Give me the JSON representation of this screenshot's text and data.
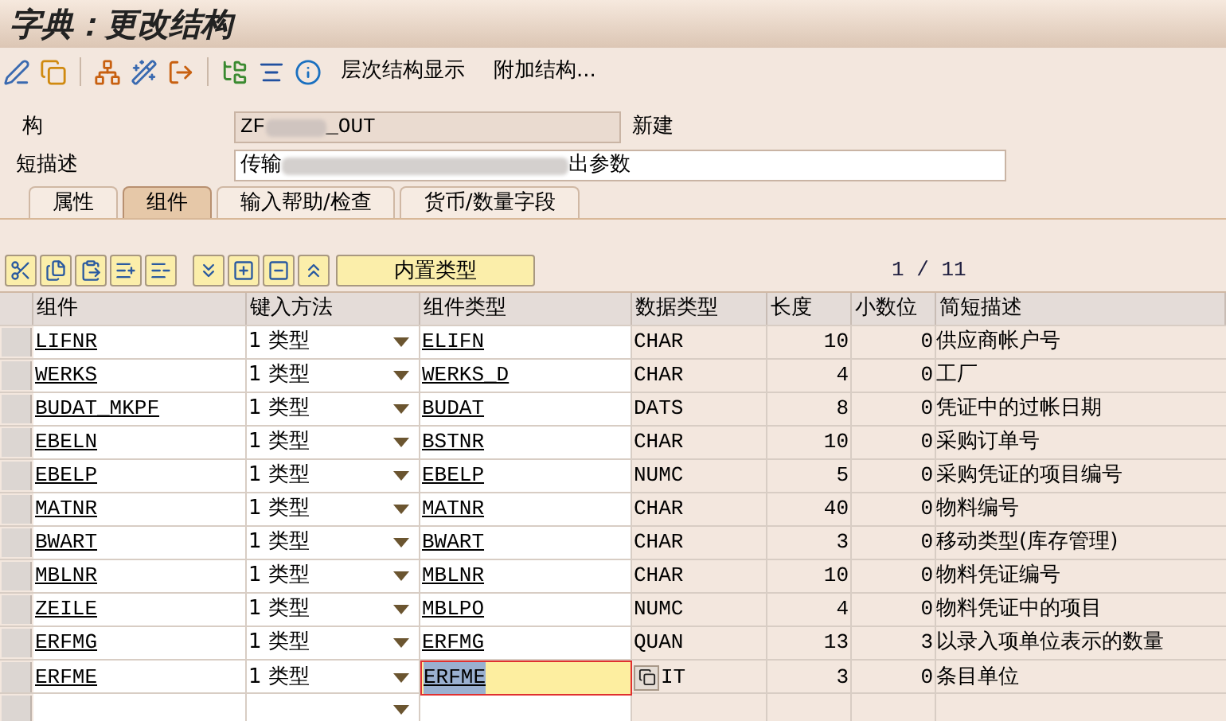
{
  "window": {
    "title": "字典：更改结构"
  },
  "toolbar": {
    "buttons": [
      "层次结构显示",
      "附加结构..."
    ]
  },
  "form": {
    "structure": {
      "label": "构",
      "value_start": "ZF",
      "value_end": "_OUT",
      "status": "新建"
    },
    "description": {
      "label": "短描述",
      "value_start": "传输",
      "value_end": "出参数"
    }
  },
  "tabs": [
    {
      "label": "属性",
      "selected": false
    },
    {
      "label": "组件",
      "selected": true
    },
    {
      "label": "输入帮助/检查",
      "selected": false
    },
    {
      "label": "货币/数量字段",
      "selected": false
    }
  ],
  "table_toolbar": {
    "button": "内置类型",
    "page": "1 / 11"
  },
  "table": {
    "columns": [
      "组件",
      "键入方法",
      "组件类型",
      "数据类型",
      "长度",
      "小数位",
      "简短描述"
    ],
    "rows": [
      {
        "component": "LIFNR",
        "entry": "1 类型",
        "type": "ELIFN",
        "data_type": "CHAR",
        "length": "10",
        "decimals": "0",
        "description": "供应商帐户号",
        "focused": false
      },
      {
        "component": "WERKS",
        "entry": "1 类型",
        "type": "WERKS_D",
        "data_type": "CHAR",
        "length": "4",
        "decimals": "0",
        "description": "工厂",
        "focused": false
      },
      {
        "component": "BUDAT_MKPF",
        "entry": "1 类型",
        "type": "BUDAT",
        "data_type": "DATS",
        "length": "8",
        "decimals": "0",
        "description": "凭证中的过帐日期",
        "focused": false
      },
      {
        "component": "EBELN",
        "entry": "1 类型",
        "type": "BSTNR",
        "data_type": "CHAR",
        "length": "10",
        "decimals": "0",
        "description": "采购订单号",
        "focused": false
      },
      {
        "component": "EBELP",
        "entry": "1 类型",
        "type": "EBELP",
        "data_type": "NUMC",
        "length": "5",
        "decimals": "0",
        "description": "采购凭证的项目编号",
        "focused": false
      },
      {
        "component": "MATNR",
        "entry": "1 类型",
        "type": "MATNR",
        "data_type": "CHAR",
        "length": "40",
        "decimals": "0",
        "description": "物料编号",
        "focused": false
      },
      {
        "component": "BWART",
        "entry": "1 类型",
        "type": "BWART",
        "data_type": "CHAR",
        "length": "3",
        "decimals": "0",
        "description": "移动类型(库存管理)",
        "focused": false
      },
      {
        "component": "MBLNR",
        "entry": "1 类型",
        "type": "MBLNR",
        "data_type": "CHAR",
        "length": "10",
        "decimals": "0",
        "description": "物料凭证编号",
        "focused": false
      },
      {
        "component": "ZEILE",
        "entry": "1 类型",
        "type": "MBLPO",
        "data_type": "NUMC",
        "length": "4",
        "decimals": "0",
        "description": "物料凭证中的项目",
        "focused": false
      },
      {
        "component": "ERFMG",
        "entry": "1 类型",
        "type": "ERFMG",
        "data_type": "QUAN",
        "length": "13",
        "decimals": "3",
        "description": "以录入项单位表示的数量",
        "focused": false
      },
      {
        "component": "ERFME",
        "entry": "1 类型",
        "type": "ERFME",
        "data_type": "IT",
        "length": "3",
        "decimals": "0",
        "description": "条目单位",
        "focused": true
      }
    ]
  }
}
